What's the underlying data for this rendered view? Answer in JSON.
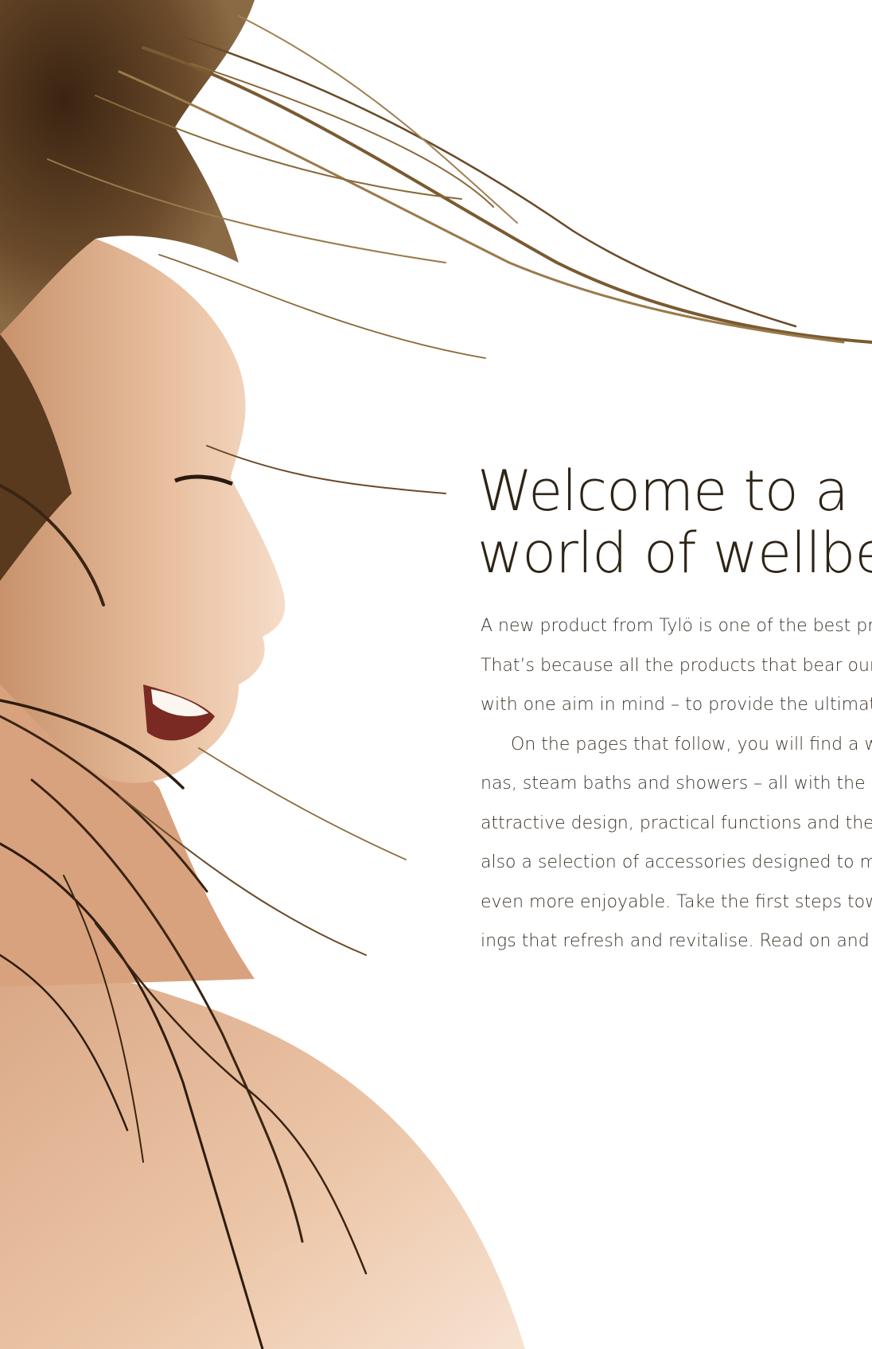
{
  "page": {
    "headline": {
      "line1": "Welcome to a",
      "line2": "world of wellbein"
    },
    "body_lines": [
      "A new product from Tylö is one of the best pre",
      "That’s because all the products that bear our n",
      "with one aim in mind – to provide the ultimate",
      "On the pages that follow, you will find a wid",
      "nas, steam baths and showers – all with the di",
      "attractive design, practical functions and the v",
      "also a selection of accessories designed to ma",
      "even more enjoyable. Take the first steps towa",
      "ings that refresh and revitalise. Read on and le"
    ]
  }
}
